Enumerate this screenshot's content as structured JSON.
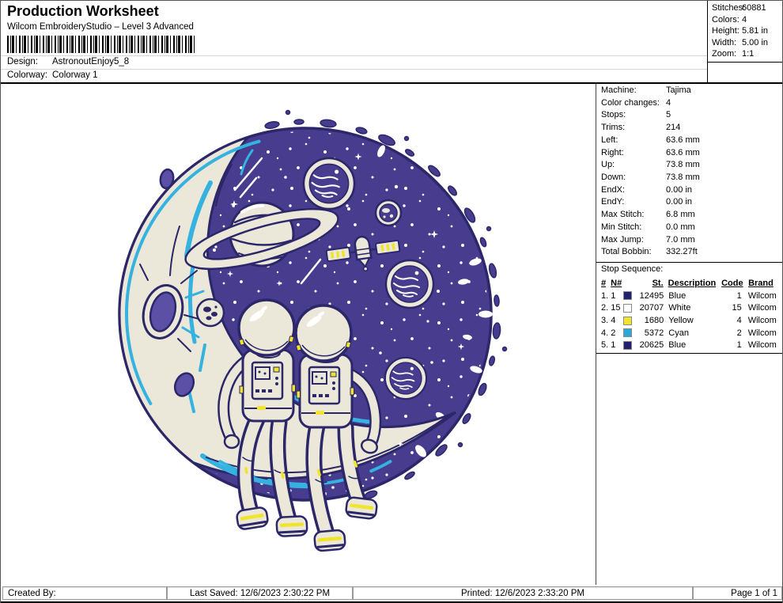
{
  "header": {
    "title": "Production Worksheet",
    "subtitle": "Wilcom EmbroideryStudio – Level 3 Advanced",
    "barcode_icon": "barcode-icon",
    "design_label": "Design:",
    "design_value": "AstronoutEnjoy5_8",
    "colorway_label": "Colorway:",
    "colorway_value": "Colorway 1"
  },
  "stats_box": {
    "rows": [
      {
        "label": "Stitches:",
        "value": "60881"
      },
      {
        "label": "Colors:",
        "value": "4"
      },
      {
        "label": "Height:",
        "value": "5.81 in"
      },
      {
        "label": "Width:",
        "value": "5.00 in"
      },
      {
        "label": "Zoom:",
        "value": "1:1"
      }
    ]
  },
  "info_panel": {
    "rows": [
      {
        "label": "Machine:",
        "value": "Tajima"
      },
      {
        "label": "Color changes:",
        "value": "4"
      },
      {
        "label": "Stops:",
        "value": "5"
      },
      {
        "label": "Trims:",
        "value": "214"
      },
      {
        "label": "Left:",
        "value": "63.6 mm"
      },
      {
        "label": "Right:",
        "value": "63.6 mm"
      },
      {
        "label": "Up:",
        "value": "73.8 mm"
      },
      {
        "label": "Down:",
        "value": "73.8 mm"
      },
      {
        "label": "EndX:",
        "value": "0.00 in"
      },
      {
        "label": "EndY:",
        "value": "0.00 in"
      },
      {
        "label": "Max Stitch:",
        "value": "6.8 mm"
      },
      {
        "label": "Min Stitch:",
        "value": "0.0 mm"
      },
      {
        "label": "Max Jump:",
        "value": "7.0 mm"
      },
      {
        "label": "Total Bobbin:",
        "value": "332.27ft"
      }
    ]
  },
  "stop_sequence": {
    "title": "Stop Sequence:",
    "columns": [
      "#",
      "N#",
      "St.",
      "Description",
      "Code",
      "Brand"
    ],
    "rows": [
      {
        "num": "1.",
        "n": "1",
        "swatch": "#23206f",
        "st": "12495",
        "description": "Blue",
        "code": "1",
        "brand": "Wilcom"
      },
      {
        "num": "2.",
        "n": "15",
        "swatch": "#ffffff",
        "st": "20707",
        "description": "White",
        "code": "15",
        "brand": "Wilcom"
      },
      {
        "num": "3.",
        "n": "4",
        "swatch": "#f0e42c",
        "st": "1680",
        "description": "Yellow",
        "code": "4",
        "brand": "Wilcom"
      },
      {
        "num": "4.",
        "n": "2",
        "swatch": "#2ba7d8",
        "st": "5372",
        "description": "Cyan",
        "code": "2",
        "brand": "Wilcom"
      },
      {
        "num": "5.",
        "n": "1",
        "swatch": "#23206f",
        "st": "20625",
        "description": "Blue",
        "code": "1",
        "brand": "Wilcom"
      }
    ]
  },
  "design_preview": {
    "artwork": "Embroidery design: two astronauts sitting on a crescent moon inside a circular space scene with planets, Saturn, satellite, comets and stars",
    "palette": {
      "space_indigo": "#473c8e",
      "outline_navy": "#2b2768",
      "thread_cream": "#ebe7d9",
      "accent_cyan": "#35b2e0",
      "accent_yellow": "#f0e42c",
      "crater_purple": "#5b50a5"
    }
  },
  "footer": {
    "created_by": "Created By:",
    "last_saved": "Last Saved: 12/6/2023 2:30:22 PM",
    "printed": "Printed: 12/6/2023 2:33:20 PM",
    "page": "Page 1 of 1"
  }
}
